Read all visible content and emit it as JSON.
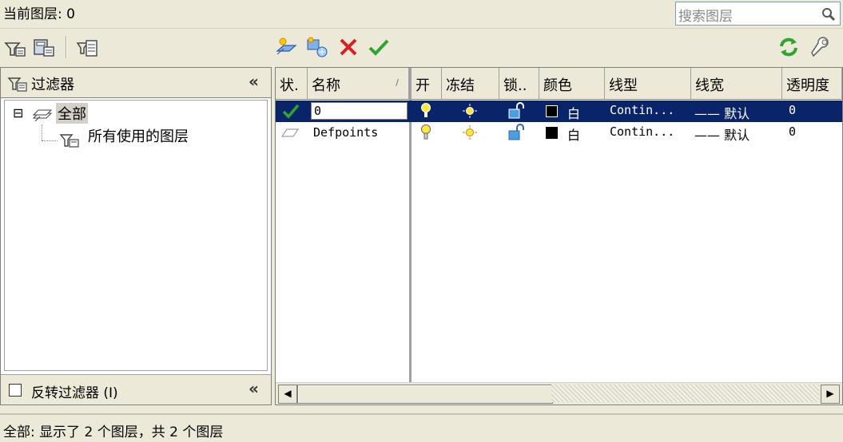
{
  "header": {
    "current_layer": "当前图层: 0",
    "search_placeholder": "搜索图层"
  },
  "filter_panel": {
    "title": "过滤器",
    "collapse_label": "«",
    "tree": {
      "root_label": "全部",
      "child_label": "所有使用的图层",
      "expander": "⊟"
    },
    "invert_label": "反转过滤器 (I)",
    "invert_checked": false
  },
  "grid": {
    "columns": [
      "状.",
      "名称",
      "开",
      "冻结",
      "锁..",
      "颜色",
      "线型",
      "线宽",
      "透明度"
    ],
    "sort_marker": "/",
    "rows": [
      {
        "status": "current",
        "name": "0",
        "color_name": "白",
        "linetype": "Contin...",
        "lineweight": "—— 默认",
        "transparency": "0",
        "selected": true
      },
      {
        "status": "normal",
        "name": "Defpoints",
        "color_name": "白",
        "linetype": "Contin...",
        "lineweight": "—— 默认",
        "transparency": "0",
        "selected": false
      }
    ]
  },
  "status_bar": {
    "text": "全部: 显示了 2 个图层，共 2 个图层"
  },
  "colors": {
    "selection": "#0a246a",
    "accent_green": "#2fa52f",
    "delete_red": "#d82020"
  }
}
